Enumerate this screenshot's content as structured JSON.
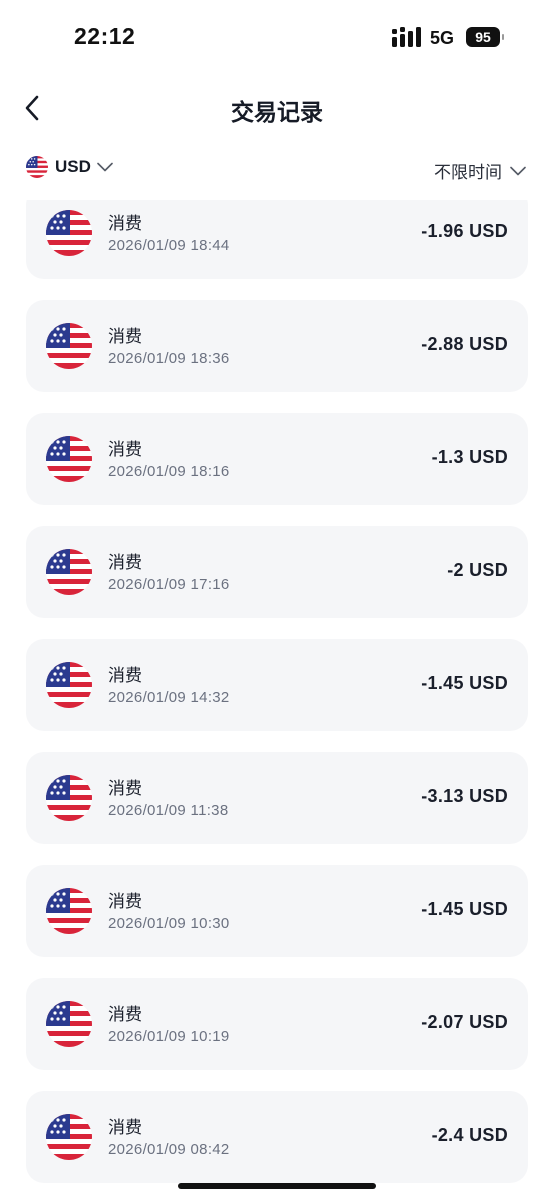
{
  "status_bar": {
    "time": "22:12",
    "network": "5G",
    "battery": "95"
  },
  "header": {
    "title": "交易记录",
    "back_icon": "chevron-left-icon"
  },
  "filters": {
    "currency": "USD",
    "currency_icon": "us-flag-icon",
    "time_range": "不限时间",
    "dropdown_icon": "chevron-down-icon"
  },
  "colors": {
    "card_bg": "#f5f6f8",
    "flag_red": "#d8243a",
    "flag_blue": "#2b3a8f"
  },
  "transactions": [
    {
      "type": "消费",
      "time": "2026/01/09 18:44",
      "amount": "-1.96 USD"
    },
    {
      "type": "消费",
      "time": "2026/01/09 18:36",
      "amount": "-2.88 USD"
    },
    {
      "type": "消费",
      "time": "2026/01/09 18:16",
      "amount": "-1.3 USD"
    },
    {
      "type": "消费",
      "time": "2026/01/09 17:16",
      "amount": "-2 USD"
    },
    {
      "type": "消费",
      "time": "2026/01/09 14:32",
      "amount": "-1.45 USD"
    },
    {
      "type": "消费",
      "time": "2026/01/09 11:38",
      "amount": "-3.13 USD"
    },
    {
      "type": "消费",
      "time": "2026/01/09 10:30",
      "amount": "-1.45 USD"
    },
    {
      "type": "消费",
      "time": "2026/01/09 10:19",
      "amount": "-2.07 USD"
    },
    {
      "type": "消费",
      "time": "2026/01/09 08:42",
      "amount": "-2.4 USD"
    }
  ]
}
